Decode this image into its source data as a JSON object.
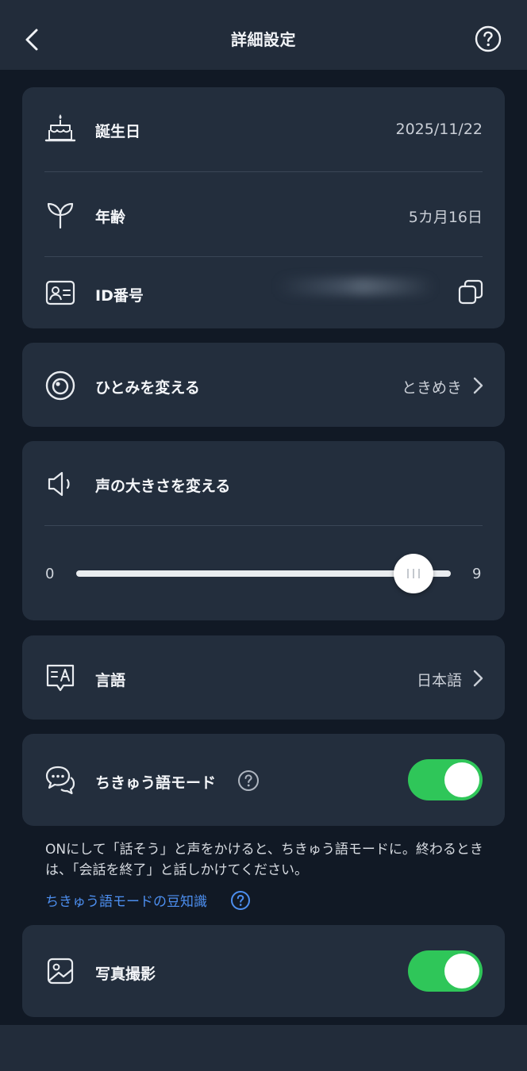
{
  "header": {
    "title": "詳細設定"
  },
  "profile": {
    "birthday_label": "誕生日",
    "birthday_value": "2025/11/22",
    "age_label": "年齢",
    "age_value": "5カ月16日",
    "id_label": "ID番号"
  },
  "eyes": {
    "label": "ひとみを変える",
    "value": "ときめき"
  },
  "volume": {
    "label": "声の大きさを変える",
    "min": "0",
    "max": "9",
    "level": 0.9
  },
  "language": {
    "label": "言語",
    "value": "日本語"
  },
  "earth_mode": {
    "label": "ちきゅう語モード",
    "enabled": true,
    "note": "ONにして「話そう」と声をかけると、ちきゅう語モードに。終わるときは、「会話を終了」と話しかけてください。",
    "tips_link": "ちきゅう語モードの豆知識"
  },
  "photo": {
    "label": "写真撮影",
    "enabled": true
  },
  "colors": {
    "background": "#111925",
    "card": "#232e3d",
    "toggle_on": "#2fc659",
    "link": "#4d8ff0"
  }
}
